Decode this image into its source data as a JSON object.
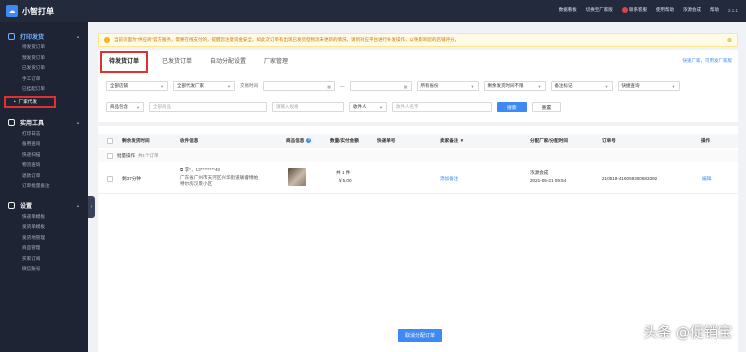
{
  "app": {
    "title": "小智打单"
  },
  "topbar": {
    "links": [
      "数据看板",
      "切换至厂家版",
      "联系客服",
      "使用帮助",
      "浓源会成",
      "帮助"
    ],
    "version": "2.1.1"
  },
  "sidebar": {
    "groups": [
      {
        "title": "打印发货",
        "items": [
          "待发货订单",
          "预发货订单",
          "已发货订单",
          "手工订单",
          "已挂起订单",
          "厂家代发"
        ]
      },
      {
        "title": "实用工具",
        "items": [
          "打印日志",
          "备用查询",
          "快递扫描",
          "物流查询",
          "退款订单",
          "订单批量备注"
        ]
      },
      {
        "title": "设置",
        "items": [
          "快递单模板",
          "发货单模板",
          "发货地管理",
          "商品管理",
          "买家订阅",
          "微信账号"
        ]
      }
    ]
  },
  "notice": {
    "text": "当前页面为“供应商”官方服务，需要在线支付的，提醒您注意资金安全。如此次订单有出现已发货但物流未更新的情况，请到对应平台进行补发操作，以免影响您的店铺评分。"
  },
  "tabs": {
    "items": [
      "待发货订单",
      "已发货订单",
      "自动分配设置",
      "厂家管理"
    ],
    "right_link": "快速厂家，可用发厂家版"
  },
  "filters": {
    "row1": {
      "shop": "全部店铺",
      "vendor": "全部代发厂家",
      "time_label": "交易时间",
      "date_sep": "—",
      "province": "所有省份",
      "ship_time": "剩余发货时间不限",
      "remark": "备注标记",
      "express": "快捷查询"
    },
    "row2": {
      "goods_type": "商品包含",
      "goods_placeholder": "全部商品",
      "receiver_placeholder": "请输入规格",
      "receiver_type": "收件人",
      "receiver_name_placeholder": "收件人名字",
      "search_btn": "搜索",
      "reset_btn": "重置"
    }
  },
  "table": {
    "headers": [
      "剩余发货时间",
      "收件信息",
      "商品信息",
      "数量/实付金额",
      "快递单号",
      "卖家备注",
      "分配厂家/分配时间",
      "订单号",
      "操作"
    ],
    "group_row": {
      "label": "批量操作",
      "count": "共1个订单"
    },
    "rows": [
      {
        "remaining": "剩37分钟",
        "receiver_name": "李*，13********40",
        "receiver_addr": "广东省广州市天河区兴华街道联睿博帕特尔房汉景小区",
        "qty": "共 1 件",
        "amount": "￥5.00",
        "remark": "添加备注",
        "vendor": "浓源会成",
        "assign_time": "2021-05-21 09:54",
        "order_no": "210519-416059300683392",
        "action": "编辑"
      }
    ]
  },
  "bottom": {
    "button": "取消分配订单"
  },
  "watermark": "头条 @促销宝"
}
